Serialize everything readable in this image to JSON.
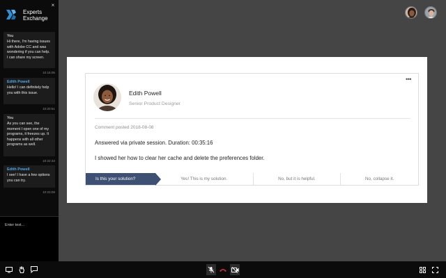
{
  "brand": {
    "line1": "Experts",
    "line2": "Exchange"
  },
  "sidebar": {
    "close_label": "×",
    "messages": [
      {
        "author": "You",
        "text": "Hi there, I'm having issues with Adobe CC and was wondering if you can help. I can share my screen.",
        "time": "10:15:05",
        "is_agent": false
      },
      {
        "author": "Edith Powell",
        "text": "Hello! I can definitely help you with this issue.",
        "time": "10:20:51",
        "is_agent": true
      },
      {
        "author": "You",
        "text": "As you can see, the moment I open one of my programs, it freezes up. It happens with all other programs as well.",
        "time": "10:22:33",
        "is_agent": false
      },
      {
        "author": "Edith Powell",
        "text": "I see! I have a few options you can try.",
        "time": "10:23:08",
        "is_agent": true
      }
    ],
    "input_placeholder": "Enter text..."
  },
  "card": {
    "menu_label": "•••",
    "name": "Edith Powell",
    "role": "Senior Product Designer",
    "posted": "Comment posted 2018-08-08",
    "line1": "Answered via private session. Duration: 00:35:16",
    "line2": "I showed her how to clear her cache and delete the preferences folder."
  },
  "answer_bar": {
    "question": "Is this your solution?",
    "option_yes": "Yes! This is my solution.",
    "option_helpful": "No, but it is helpful.",
    "option_collapse": "No, collapse it."
  },
  "colors": {
    "background": "#454545",
    "sidebar": "#0b0b0b",
    "accent_agent": "#4aa8e8",
    "question_fill": "#3e5073",
    "hangup": "#e0363a"
  },
  "icons": [
    "close-icon",
    "experts-exchange-logo-icon",
    "screen-share-icon",
    "raise-hand-icon",
    "chat-icon",
    "mic-off-icon",
    "hang-up-icon",
    "camera-off-icon",
    "grid-view-icon",
    "fullscreen-icon",
    "more-icon"
  ]
}
